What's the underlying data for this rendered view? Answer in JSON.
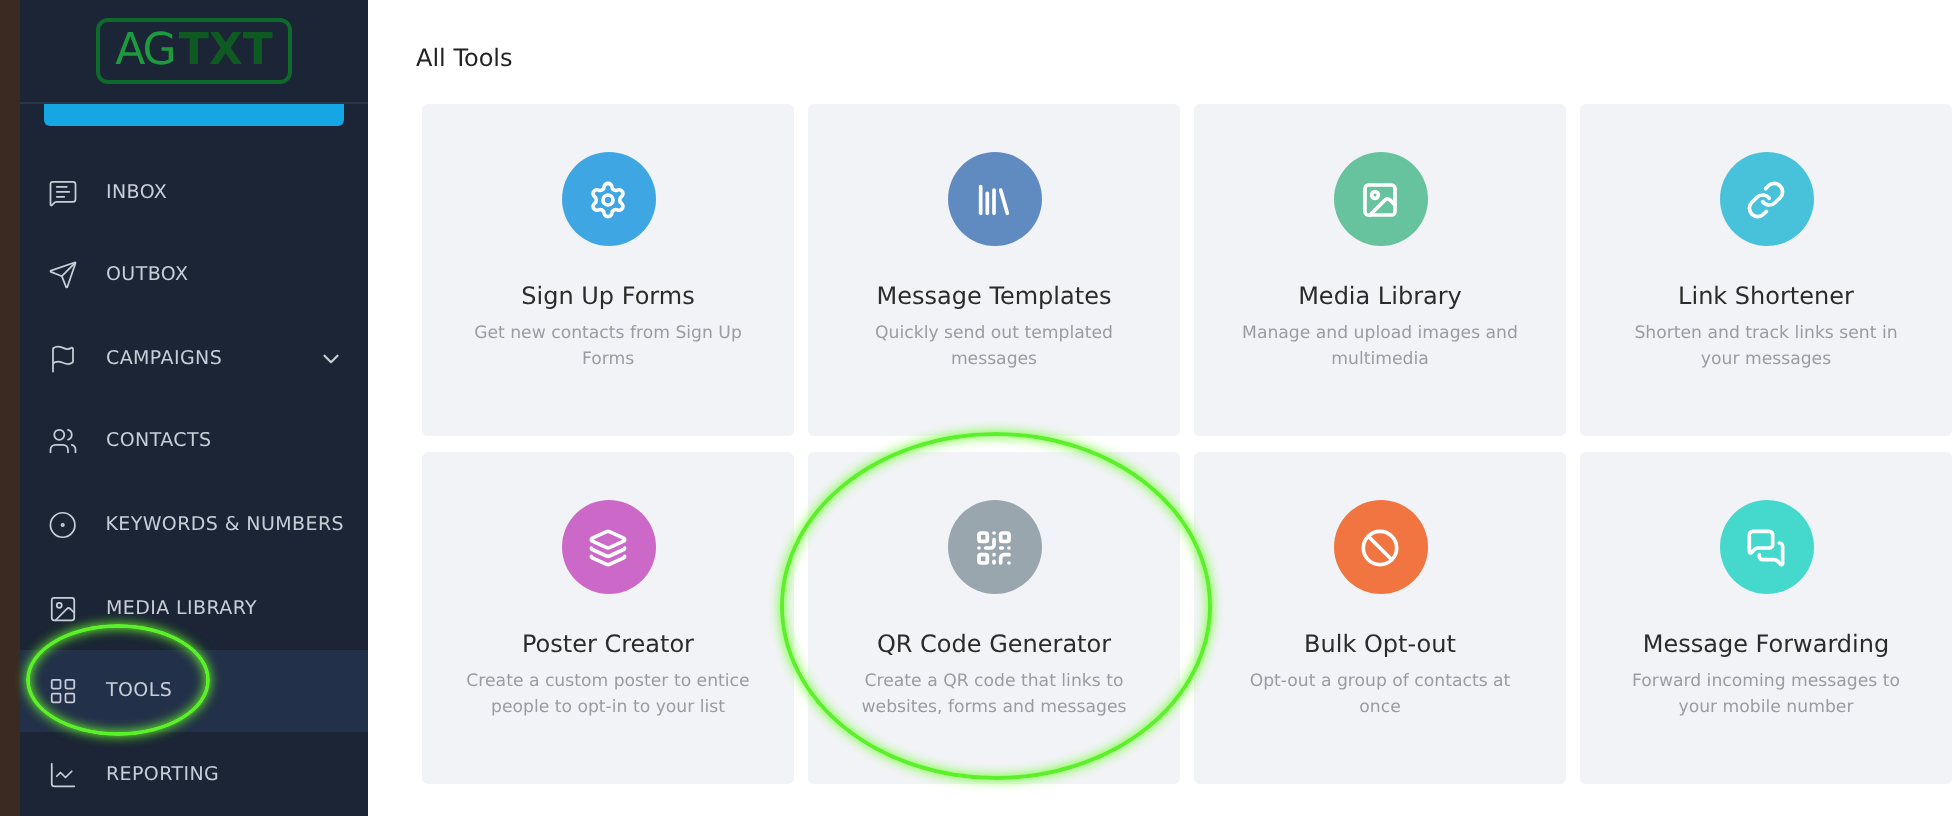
{
  "logo": {
    "part_1": "AG",
    "part_2": "TXT"
  },
  "sidebar": {
    "items": [
      {
        "label": "INBOX",
        "selected": false
      },
      {
        "label": "OUTBOX",
        "selected": false
      },
      {
        "label": "CAMPAIGNS",
        "selected": false,
        "expandable": true
      },
      {
        "label": "CONTACTS",
        "selected": false
      },
      {
        "label": "KEYWORDS & NUMBERS",
        "selected": false
      },
      {
        "label": "MEDIA LIBRARY",
        "selected": false
      },
      {
        "label": "TOOLS",
        "selected": true
      },
      {
        "label": "REPORTING",
        "selected": false
      }
    ]
  },
  "main": {
    "title": "All Tools",
    "tools": [
      {
        "title": "Sign Up Forms",
        "description": "Get new contacts from Sign Up Forms",
        "color": "#3ea6e3"
      },
      {
        "title": "Message Templates",
        "description": "Quickly send out templated messages",
        "color": "#5f8bc0"
      },
      {
        "title": "Media Library",
        "description": "Manage and upload images and multimedia",
        "color": "#66c39e"
      },
      {
        "title": "Link Shortener",
        "description": "Shorten and track links sent in your messages",
        "color": "#48c1da"
      },
      {
        "title": "Poster Creator",
        "description": "Create a custom poster to entice people to opt-in to your list",
        "color": "#cc68c8"
      },
      {
        "title": "QR Code Generator",
        "description": "Create a QR code that links to websites, forms and messages",
        "color": "#9aa6ad"
      },
      {
        "title": "Bulk Opt-out",
        "description": "Opt-out a group of contacts at once",
        "color": "#f07540"
      },
      {
        "title": "Message Forwarding",
        "description": "Forward incoming messages to your mobile number",
        "color": "#45d8cc"
      }
    ]
  }
}
